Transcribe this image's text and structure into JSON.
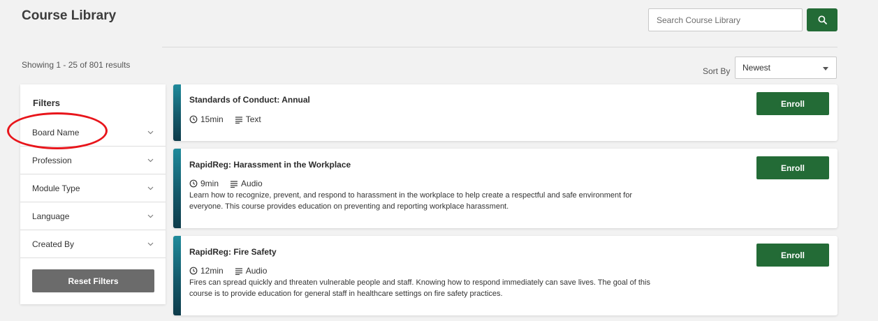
{
  "header": {
    "title": "Course Library",
    "search_placeholder": "Search Course Library"
  },
  "results": {
    "summary": "Showing 1 - 25 of 801 results",
    "sort_label": "Sort By",
    "sort_value": "Newest"
  },
  "filters": {
    "title": "Filters",
    "items": [
      {
        "label": "Board Name"
      },
      {
        "label": "Profession"
      },
      {
        "label": "Module Type"
      },
      {
        "label": "Language"
      },
      {
        "label": "Created By"
      }
    ],
    "reset_label": "Reset Filters"
  },
  "courses": [
    {
      "title": "Standards of Conduct: Annual",
      "duration": "15min",
      "format": "Text",
      "description": "",
      "enroll_label": "Enroll"
    },
    {
      "title": "RapidReg: Harassment in the Workplace",
      "duration": "9min",
      "format": "Audio",
      "description": "Learn how to recognize, prevent, and respond to harassment in the workplace to help create a respectful and safe environment for everyone. This course provides education on preventing and reporting workplace harassment.",
      "enroll_label": "Enroll"
    },
    {
      "title": "RapidReg: Fire Safety",
      "duration": "12min",
      "format": "Audio",
      "description": "Fires can spread quickly and threaten vulnerable people and staff. Knowing how to respond immediately can save lives. The goal of this course is to provide education for general staff in healthcare settings on fire safety practices.",
      "enroll_label": "Enroll"
    }
  ],
  "colors": {
    "primary_green": "#236b36",
    "accent_teal": "#14596a",
    "annotation_red": "#e8151b",
    "reset_gray": "#6b6b6b"
  },
  "icons": {
    "search": "search-icon",
    "clock": "clock-icon",
    "format": "lines-icon",
    "chevron": "chevron-down-icon",
    "sort_caret": "caret-down-icon"
  }
}
